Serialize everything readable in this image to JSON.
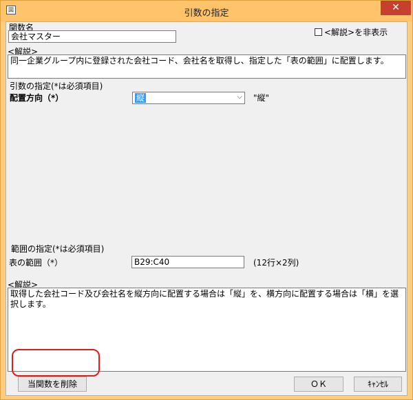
{
  "window": {
    "title": "引数の指定",
    "close_label": "✕",
    "icon_glyph": "図"
  },
  "function_name": {
    "label": "関数名",
    "value": "会社マスター"
  },
  "hide_description": {
    "label": "<解説>を非表示",
    "checked": false
  },
  "description_top": {
    "label": "<解説>",
    "text": "同一企業グループ内に登録された会社コード、会社名を取得し、指定した「表の範囲」に配置します。"
  },
  "args_section": {
    "title": "引数の指定(*は必須項目)",
    "placement_label": "配置方向（*）",
    "placement_value": "縦",
    "placement_hint": "\"縦\""
  },
  "range_section": {
    "title": "範囲の指定(*は必須項目)",
    "range_label": "表の範囲（*）",
    "range_value": "B29:C40",
    "range_hint": "(12行×2列)"
  },
  "description_bottom": {
    "label": "<解説>",
    "text": "取得した会社コード及び会社名を縦方向に配置する場合は「縦」を、横方向に配置する場合は「横」を選択します。"
  },
  "buttons": {
    "delete": "当関数を削除",
    "ok": "ＯＫ",
    "cancel": "ｷｬﾝｾﾙ"
  },
  "colors": {
    "titlebar": "#ffc36b",
    "close": "#c7402f",
    "highlight": "#e01b1b",
    "selection": "#3399ff"
  }
}
